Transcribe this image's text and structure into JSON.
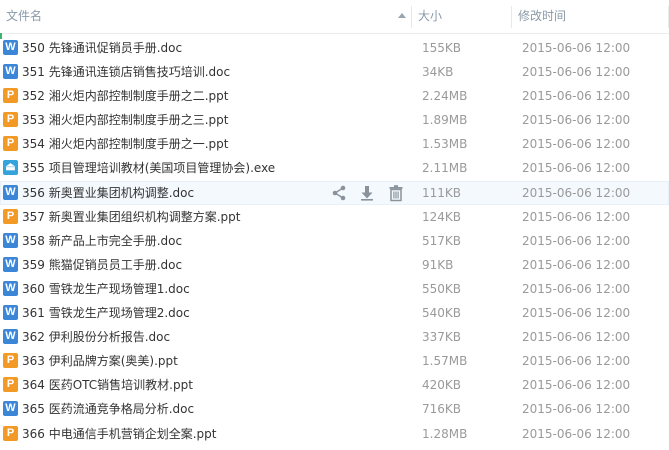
{
  "header": {
    "name_label": "文件名",
    "size_label": "大小",
    "date_label": "修改时间"
  },
  "actions": {
    "share_icon": "share-icon",
    "download_icon": "download-icon",
    "delete_icon": "trash-icon"
  },
  "files": [
    {
      "type": "doc",
      "icon": "W",
      "name": "350 先锋通讯促销员手册.doc",
      "size": "155KB",
      "date": "2015-06-06 12:00"
    },
    {
      "type": "doc",
      "icon": "W",
      "name": "351 先锋通讯连锁店销售技巧培训.doc",
      "size": "34KB",
      "date": "2015-06-06 12:00"
    },
    {
      "type": "ppt",
      "icon": "P",
      "name": "352 湘火炬内部控制制度手册之二.ppt",
      "size": "2.24MB",
      "date": "2015-06-06 12:00"
    },
    {
      "type": "ppt",
      "icon": "P",
      "name": "353 湘火炬内部控制制度手册之三.ppt",
      "size": "1.89MB",
      "date": "2015-06-06 12:00"
    },
    {
      "type": "ppt",
      "icon": "P",
      "name": "354 湘火炬内部控制制度手册之一.ppt",
      "size": "1.53MB",
      "date": "2015-06-06 12:00"
    },
    {
      "type": "exe",
      "icon": "⏏",
      "name": "355 项目管理培训教材(美国项目管理协会).exe",
      "size": "2.11MB",
      "date": "2015-06-06 12:00"
    },
    {
      "type": "doc",
      "icon": "W",
      "name": "356 新奥置业集团机构调整.doc",
      "size": "111KB",
      "date": "2015-06-06 12:00"
    },
    {
      "type": "ppt",
      "icon": "P",
      "name": "357 新奥置业集团组织机构调整方案.ppt",
      "size": "124KB",
      "date": "2015-06-06 12:00"
    },
    {
      "type": "doc",
      "icon": "W",
      "name": "358 新产品上市完全手册.doc",
      "size": "517KB",
      "date": "2015-06-06 12:00"
    },
    {
      "type": "doc",
      "icon": "W",
      "name": "359 熊猫促销员员工手册.doc",
      "size": "91KB",
      "date": "2015-06-06 12:00"
    },
    {
      "type": "doc",
      "icon": "W",
      "name": "360 雪铁龙生产现场管理1.doc",
      "size": "550KB",
      "date": "2015-06-06 12:00"
    },
    {
      "type": "doc",
      "icon": "W",
      "name": "361 雪铁龙生产现场管理2.doc",
      "size": "540KB",
      "date": "2015-06-06 12:00"
    },
    {
      "type": "doc",
      "icon": "W",
      "name": "362 伊利股份分析报告.doc",
      "size": "337KB",
      "date": "2015-06-06 12:00"
    },
    {
      "type": "ppt",
      "icon": "P",
      "name": "363 伊利品牌方案(奥美).ppt",
      "size": "1.57MB",
      "date": "2015-06-06 12:00"
    },
    {
      "type": "ppt",
      "icon": "P",
      "name": "364 医药OTC销售培训教材.ppt",
      "size": "420KB",
      "date": "2015-06-06 12:00"
    },
    {
      "type": "doc",
      "icon": "W",
      "name": "365 医药流通竞争格局分析.doc",
      "size": "716KB",
      "date": "2015-06-06 12:00"
    },
    {
      "type": "ppt",
      "icon": "P",
      "name": "366 中电通信手机营销企划全案.ppt",
      "size": "1.28MB",
      "date": "2015-06-06 12:00"
    }
  ],
  "hover_row": 6,
  "colors": {
    "doc": "#3b86d6",
    "ppt": "#f29a25",
    "exe": "#35a4dd",
    "accent": "#3cb371"
  }
}
